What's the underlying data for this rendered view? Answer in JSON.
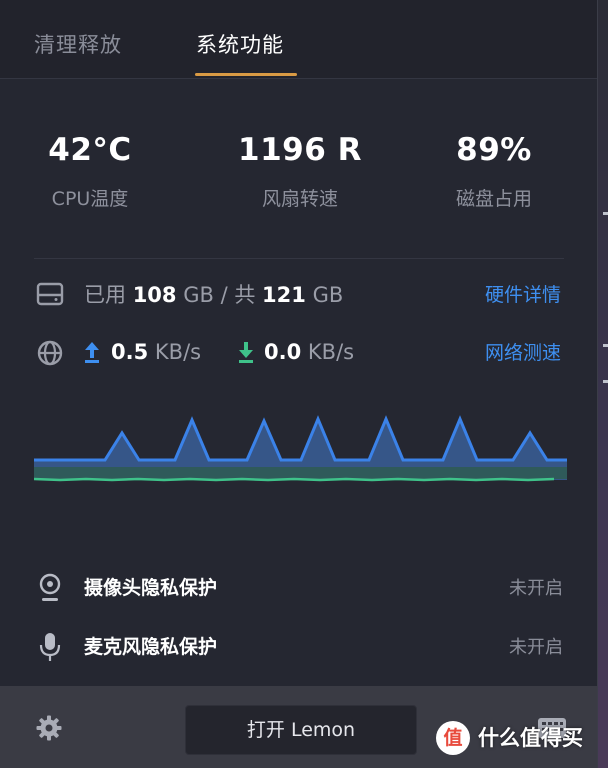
{
  "tabs": [
    {
      "label": "清理释放",
      "active": false
    },
    {
      "label": "系统功能",
      "active": true
    }
  ],
  "stats": {
    "cpu_temp": {
      "value": "42°C",
      "label": "CPU温度"
    },
    "fan_speed": {
      "value": "1196 R",
      "label": "风扇转速"
    },
    "disk_usage": {
      "value": "89%",
      "label": "磁盘占用"
    }
  },
  "disk": {
    "used_prefix": "已用",
    "used_value": "108",
    "used_unit": "GB",
    "separator": "/",
    "total_prefix": "共",
    "total_value": "121",
    "total_unit": "GB",
    "link": "硬件详情"
  },
  "network": {
    "upload_value": "0.5",
    "upload_unit": "KB/s",
    "download_value": "0.0",
    "download_unit": "KB/s",
    "link": "网络测速"
  },
  "chart_data": {
    "type": "area",
    "series": [
      {
        "color": "#3b82e8",
        "values": [
          0.3,
          0.3,
          0.3,
          0.3,
          0.3,
          0.3,
          0.3,
          0.3,
          0.3,
          0.3,
          0.3,
          0.3,
          0.3,
          0.3,
          0.3,
          0.3,
          0.3,
          0.3,
          0.3,
          0.3
        ]
      },
      {
        "color": "#3b82e8",
        "values": []
      }
    ]
  },
  "privacy": {
    "camera": {
      "label": "摄像头隐私保护",
      "status": "未开启"
    },
    "microphone": {
      "label": "麦克风隐私保护",
      "status": "未开启"
    }
  },
  "footer": {
    "open_button": "打开 Lemon"
  },
  "watermark": {
    "badge": "值",
    "text": "什么值得买"
  },
  "colors": {
    "accent_blue": "#3e8ff0",
    "upload_arrow": "#3e8ff0",
    "download_arrow": "#3fc28a",
    "tab_underline": "#d99a44"
  }
}
